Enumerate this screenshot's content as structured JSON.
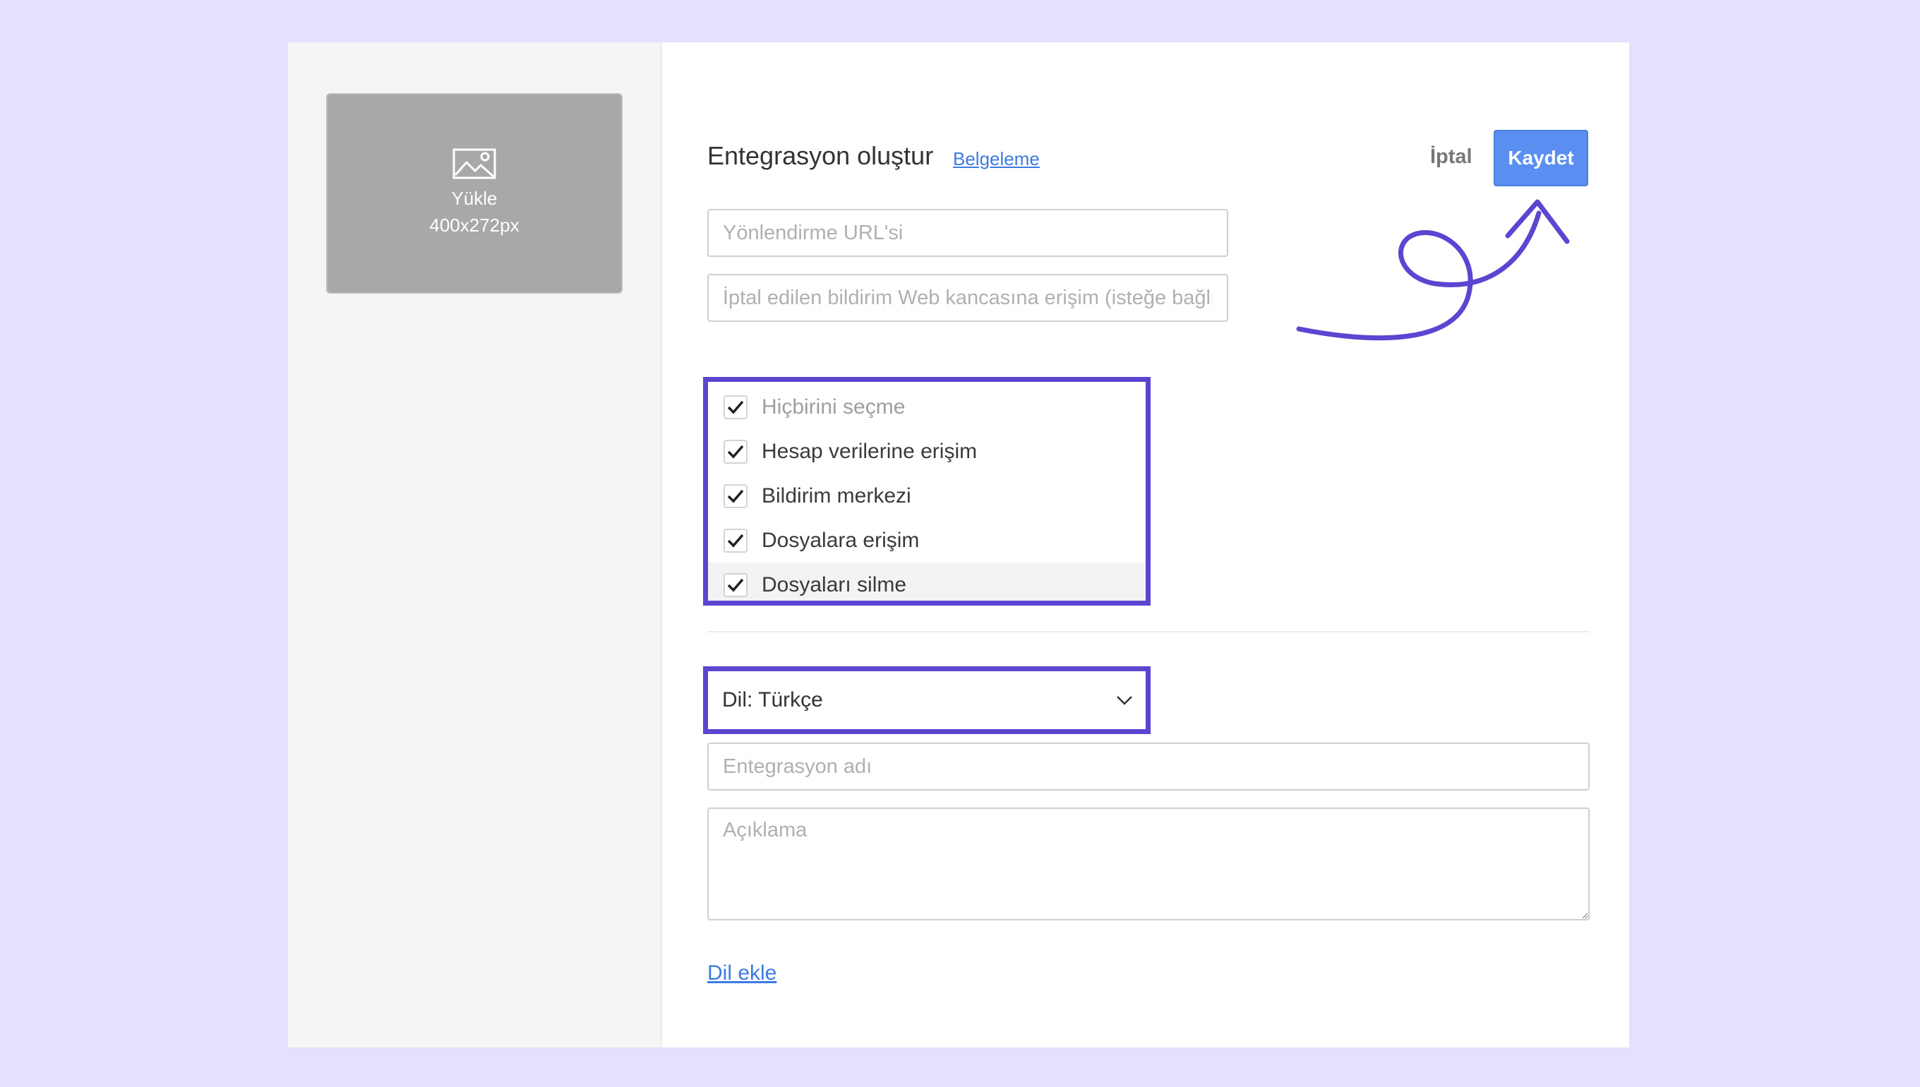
{
  "sidebar": {
    "upload": {
      "label": "Yükle",
      "size_hint": "400x272px"
    }
  },
  "header": {
    "title": "Entegrasyon oluştur",
    "doc_link": "Belgeleme",
    "cancel_label": "İptal",
    "save_label": "Kaydet"
  },
  "form": {
    "redirect_placeholder": "Yönlendirme URL'si",
    "webhook_placeholder": "İptal edilen bildirim Web kancasına erişim (isteğe bağlı)",
    "permissions": [
      {
        "label": "Hiçbirini seçme",
        "checked": true
      },
      {
        "label": "Hesap verilerine erişim",
        "checked": true
      },
      {
        "label": "Bildirim merkezi",
        "checked": true
      },
      {
        "label": "Dosyalara erişim",
        "checked": true
      },
      {
        "label": "Dosyaları silme",
        "checked": true
      }
    ],
    "language_select": "Dil: Türkçe",
    "name_placeholder": "Entegrasyon adı",
    "description_placeholder": "Açıklama",
    "add_language_link": "Dil ekle"
  },
  "colors": {
    "background": "#e4e0fd",
    "highlight": "#5b45d1",
    "primary_button": "#5a8ef0",
    "link": "#3d7be0"
  },
  "icons": [
    "image-icon",
    "check-icon",
    "chevron-down-icon"
  ]
}
